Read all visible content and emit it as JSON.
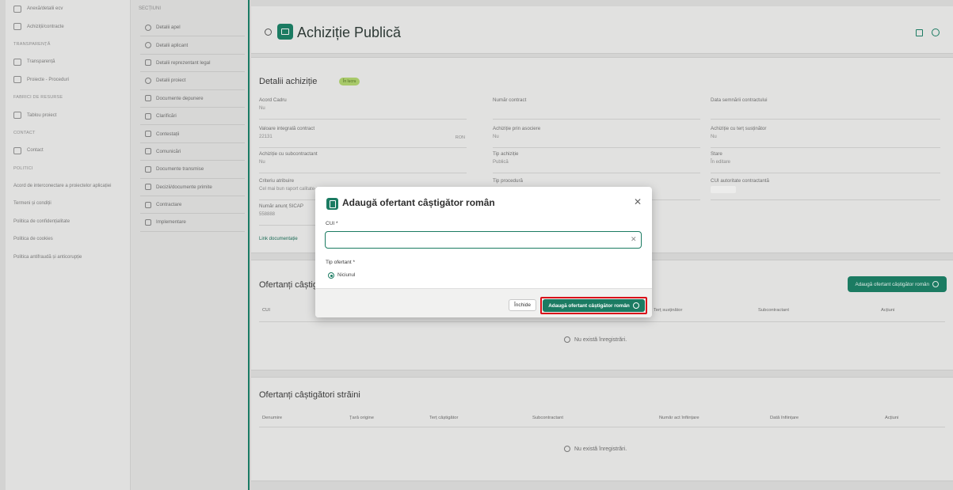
{
  "leftnav": {
    "items": [
      {
        "label": "Anexă/detalii ecv",
        "type": "item"
      },
      {
        "label": "Achiziții/contracte",
        "type": "item"
      },
      {
        "label": "TRANSPARENȚĂ",
        "type": "section"
      },
      {
        "label": "Transparență",
        "type": "item"
      },
      {
        "label": "Proiecte - Proceduri",
        "type": "item"
      },
      {
        "label": "FABRICI DE RESURSE",
        "type": "section"
      },
      {
        "label": "Tablou proiect",
        "type": "item"
      },
      {
        "label": "CONTACT",
        "type": "section"
      },
      {
        "label": "Contact",
        "type": "item"
      },
      {
        "label": "POLITICI",
        "type": "section"
      },
      {
        "label": "Acord de interconectare a proiectelor aplicației",
        "type": "link"
      },
      {
        "label": "Termeni și condiții",
        "type": "link"
      },
      {
        "label": "Politica de confidențialitate",
        "type": "link"
      },
      {
        "label": "Politica de cookies",
        "type": "link"
      },
      {
        "label": "Politica antifraudă și anticorupție",
        "type": "link"
      }
    ]
  },
  "secnav": {
    "header": "SECȚIUNI",
    "items": [
      {
        "label": "Detalii apel",
        "icon": "info-icon"
      },
      {
        "label": "Detalii aplicant",
        "icon": "info-icon"
      },
      {
        "label": "Detalii reprezentant legal",
        "icon": "id-card-icon"
      },
      {
        "label": "Detalii proiect",
        "icon": "info-icon"
      },
      {
        "label": "Documente depunere",
        "icon": "document-icon"
      },
      {
        "label": "Clarificări",
        "icon": "question-icon"
      },
      {
        "label": "Contestații",
        "icon": "warning-icon"
      },
      {
        "label": "Comunicări",
        "icon": "chat-icon"
      },
      {
        "label": "Documente transmise",
        "icon": "document-icon"
      },
      {
        "label": "Decizii/documente primite",
        "icon": "document-icon"
      },
      {
        "label": "Contractare",
        "icon": "contract-icon"
      },
      {
        "label": "Implementare",
        "icon": "table-icon"
      }
    ]
  },
  "topbar": {
    "title": "Achiziție Publică"
  },
  "details": {
    "title": "Detalii achiziție",
    "status": "În lucru",
    "fields": [
      {
        "label": "Acord Cadru",
        "value": "Nu",
        "col": 0,
        "row": 0
      },
      {
        "label": "Număr contract",
        "value": "",
        "col": 1,
        "row": 0
      },
      {
        "label": "Data semnării contractului",
        "value": "",
        "col": 2,
        "row": 0
      },
      {
        "label": "Valoare integrală contract",
        "value": "22131",
        "unit": "RON",
        "col": 0,
        "row": 1
      },
      {
        "label": "Achiziție prin asociere",
        "value": "Nu",
        "col": 1,
        "row": 1
      },
      {
        "label": "Achiziție cu terț susținător",
        "value": "Nu",
        "col": 2,
        "row": 1
      },
      {
        "label": "Achiziție cu subcontractant",
        "value": "Nu",
        "col": 0,
        "row": 2
      },
      {
        "label": "Tip achiziție",
        "value": "Publică",
        "col": 1,
        "row": 2
      },
      {
        "label": "Stare",
        "value": "În editare",
        "col": 2,
        "row": 2
      },
      {
        "label": "Criteriu atribuire",
        "value": "Cel mai bun raport calitate-preț",
        "col": 0,
        "row": 3
      },
      {
        "label": "Tip procedură",
        "value": "",
        "col": 1,
        "row": 3
      },
      {
        "label": "CUI autoritate contractantă",
        "value": "",
        "col": 2,
        "row": 3
      },
      {
        "label": "Număr anunț SICAP",
        "value": "558888",
        "col": 0,
        "row": 4
      }
    ],
    "doc_link": "Link documentație"
  },
  "winners_ro": {
    "title": "Ofertanți câștigători români",
    "add_button": "Adaugă ofertant câștigător român",
    "columns": [
      "CUI",
      "Terț susținător",
      "Subcontractant",
      "Acțiuni"
    ],
    "empty": "Nu există înregistrări."
  },
  "winners_foreign": {
    "title": "Ofertanți câștigători străini",
    "columns": [
      "Denumire",
      "Țară origine",
      "Terț câștigător",
      "Subcontractant",
      "Număr act înființare",
      "Dată înființare",
      "Acțiuni"
    ],
    "empty": "Nu există înregistrări."
  },
  "modal": {
    "title": "Adaugă ofertant câștigător român",
    "cui_label": "CUI *",
    "cui_value": "",
    "type_label": "Tip ofertant *",
    "type_option": "Niciunul",
    "close_button": "Închide",
    "submit_button": "Adaugă ofertant câștigător român"
  },
  "colors": {
    "accent": "#1b7b62",
    "highlight": "#d9101a"
  }
}
